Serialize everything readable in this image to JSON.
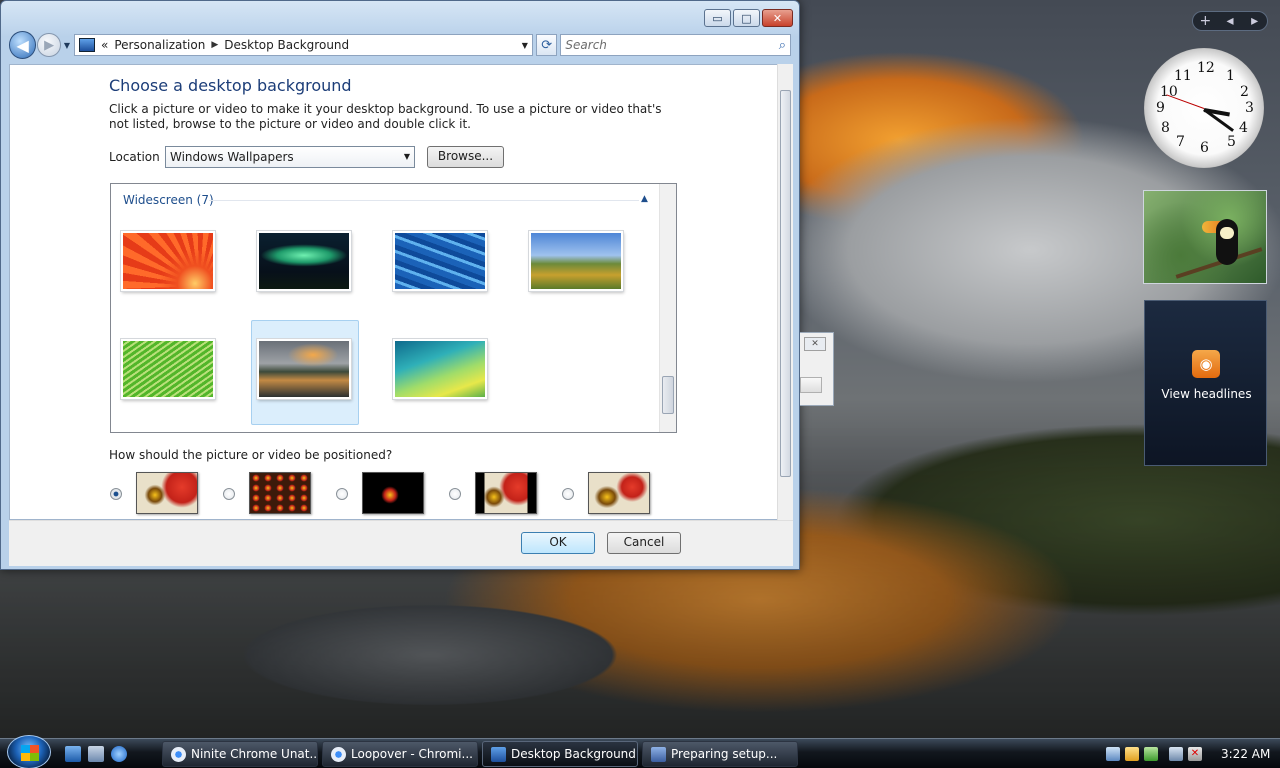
{
  "window": {
    "breadcrumb_prefix": "«",
    "breadcrumb": [
      "Personalization",
      "Desktop Background"
    ],
    "search_placeholder": "Search",
    "caption": {
      "minimize": "▭",
      "maximize": "□",
      "close": "✕"
    }
  },
  "page": {
    "title": "Choose a desktop background",
    "description": "Click a picture or video to make it your desktop background. To use a picture or video that's not listed, browse to the picture or video and double click it.",
    "location_label": "Location",
    "location_value": "Windows Wallpapers",
    "browse_label": "Browse...",
    "group_header": "Widescreen (7)",
    "position_question": "How should the picture or video be positioned?",
    "ok_label": "OK",
    "cancel_label": "Cancel"
  },
  "wallpapers": [
    {
      "name": "red-flower-thumbnail"
    },
    {
      "name": "aurora-thumbnail"
    },
    {
      "name": "fish-thumbnail"
    },
    {
      "name": "landscape-thumbnail"
    },
    {
      "name": "palm-leaf-thumbnail"
    },
    {
      "name": "mountain-lake-thumbnail",
      "selected": true
    },
    {
      "name": "vista-aurora-thumbnail"
    }
  ],
  "position_options": [
    {
      "name": "fit-to-screen",
      "selected": true
    },
    {
      "name": "tile",
      "selected": false
    },
    {
      "name": "center",
      "selected": false
    },
    {
      "name": "fit-with-bars",
      "selected": false
    },
    {
      "name": "stretch",
      "selected": false
    }
  ],
  "sidebar": {
    "controls": [
      "+",
      "◂",
      "▸"
    ],
    "clock_numbers": [
      "12",
      "1",
      "2",
      "3",
      "4",
      "5",
      "6",
      "7",
      "8",
      "9",
      "10",
      "11"
    ],
    "feed_label": "View headlines"
  },
  "taskbar": {
    "tasks": [
      "Ninite Chrome Unat...",
      "Loopover - Chromi...",
      "Desktop Background",
      "Preparing setup..."
    ],
    "active_task": "Desktop Background",
    "time": "3:22 AM"
  },
  "colors": {
    "accent": "#1c3d78",
    "selection": "#dbeefc",
    "rss": "#e26a0e"
  }
}
